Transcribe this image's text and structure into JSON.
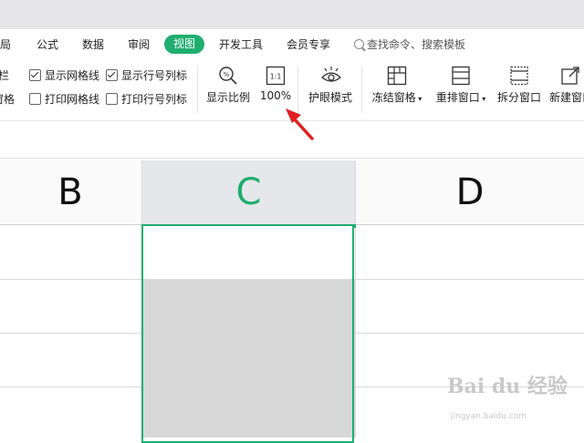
{
  "menu": {
    "items": [
      {
        "label": "布局",
        "id": "layout"
      },
      {
        "label": "公式",
        "id": "formula"
      },
      {
        "label": "数据",
        "id": "data"
      },
      {
        "label": "审阅",
        "id": "review"
      },
      {
        "label": "视图",
        "id": "view"
      },
      {
        "label": "开发工具",
        "id": "devtools"
      },
      {
        "label": "会员专享",
        "id": "member"
      }
    ],
    "active": "视图",
    "search_placeholder": "查找命令、搜索模板"
  },
  "ribbon": {
    "left_partial_top": "栏",
    "left_partial_bottom": "窗格",
    "checkboxes": {
      "gridlines": {
        "label": "显示网格线",
        "checked": true
      },
      "headers": {
        "label": "显示行号列标",
        "checked": true
      },
      "print_gridlines": {
        "label": "打印网格线",
        "checked": false
      },
      "print_headers": {
        "label": "打印行号列标",
        "checked": false
      }
    },
    "buttons": {
      "zoom": "显示比例",
      "zoom_value": "100%",
      "zoom_icon_text": "1:1",
      "eye_mode": "护眼模式",
      "freeze": "冻结窗格",
      "rearrange": "重排窗口",
      "split": "拆分窗口",
      "new_window": "新建窗口"
    }
  },
  "sheet": {
    "columns": [
      "B",
      "C",
      "D"
    ],
    "selected_column": "C",
    "accent": "#1fae6f"
  },
  "annotation": {
    "arrow_color": "#e02020"
  },
  "watermark": {
    "brand": "Bai du 经验",
    "sub": "jingyan.baidu.com"
  }
}
